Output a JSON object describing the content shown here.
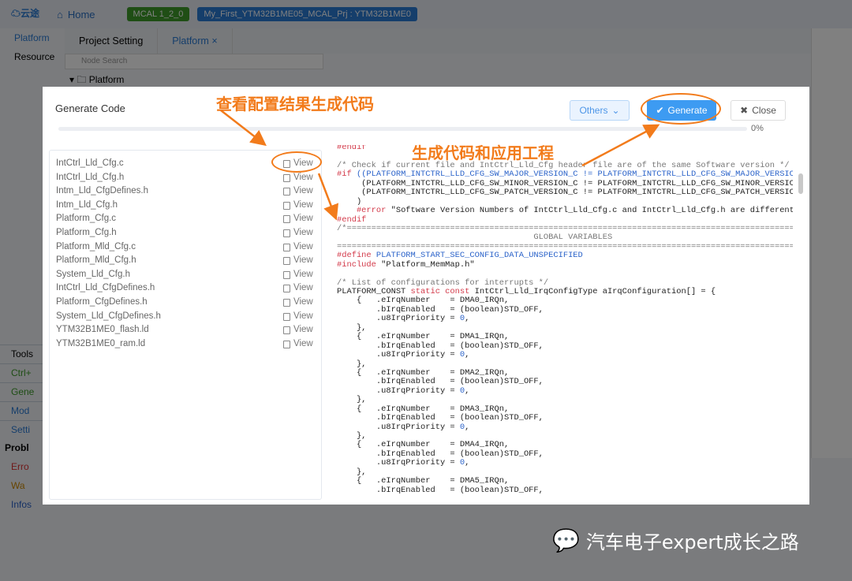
{
  "topbar": {
    "home": "Home",
    "mcal_badge": "MCAL 1_2_0",
    "project_badge": "My_First_YTM32B1ME05_MCAL_Prj : YTM32B1ME0"
  },
  "left_nav": [
    "Platform",
    "Resource"
  ],
  "tabs": [
    {
      "label": "Project Setting"
    },
    {
      "label": "Platform",
      "close": "×"
    }
  ],
  "search": {
    "placeholder": "Node Search"
  },
  "tree": {
    "root": "Platform"
  },
  "tools": {
    "header": "Tools",
    "items": [
      "Ctrl+",
      "Gene",
      "Mod",
      "Setti"
    ]
  },
  "problems": {
    "header": "Probl",
    "items": [
      "Erro",
      "Wa",
      "Infos"
    ]
  },
  "dialog": {
    "title": "Generate Code",
    "others": "Others",
    "generate": "Generate",
    "close": "Close",
    "progress_percent": 0,
    "progress_text": "0%",
    "view_label": "View",
    "files": [
      "IntCtrl_Lld_Cfg.c",
      "IntCtrl_Lld_Cfg.h",
      "Intm_Lld_CfgDefines.h",
      "Intm_Lld_Cfg.h",
      "Platform_Cfg.c",
      "Platform_Cfg.h",
      "Platform_Mld_Cfg.c",
      "Platform_Mld_Cfg.h",
      "System_Lld_Cfg.h",
      "IntCtrl_Lld_CfgDefines.h",
      "Platform_CfgDefines.h",
      "System_Lld_CfgDefines.h",
      "YTM32B1ME0_flash.ld",
      "YTM32B1ME0_ram.ld"
    ],
    "code": [
      [
        [
          "#endif",
          "pp"
        ]
      ],
      [],
      [
        [
          "/* Check if current file and IntCtrl_Lld_Cfg header file are of the same Software version */",
          "cm"
        ]
      ],
      [
        [
          "#if ",
          "pp"
        ],
        [
          "((PLATFORM_INTCTRL_LLD_CFG_SW_MAJOR_VERSION_C != PLATFORM_INTCTRL_LLD_CFG_SW_MAJOR_VERSIC",
          "id"
        ]
      ],
      [
        [
          "     (PLATFORM_INTCTRL_LLD_CFG_SW_MINOR_VERSION_C != PLATFORM_INTCTRL_LLD_CFG_SW_MINOR_VERSIC",
          "tx"
        ]
      ],
      [
        [
          "     (PLATFORM_INTCTRL_LLD_CFG_SW_PATCH_VERSION_C != PLATFORM_INTCTRL_LLD_CFG_SW_PATCH_VERSIC",
          "tx"
        ]
      ],
      [
        [
          "    )",
          "tx"
        ]
      ],
      [
        [
          "    #error ",
          "pp"
        ],
        [
          "\"Software Version Numbers of IntCtrl_Lld_Cfg.c and IntCtrl_Lld_Cfg.h are different",
          "tx"
        ]
      ],
      [
        [
          "#endif",
          "pp"
        ]
      ],
      [
        [
          "/*=============================================================================================",
          "cm"
        ]
      ],
      [
        [
          "                                        GLOBAL VARIABLES",
          "cm"
        ]
      ],
      [
        [
          "==============================================================================================",
          "cm"
        ]
      ],
      [
        [
          "#define ",
          "pp"
        ],
        [
          "PLATFORM_START_SEC_CONFIG_DATA_UNSPECIFIED",
          "id"
        ]
      ],
      [
        [
          "#include ",
          "pp"
        ],
        [
          "\"Platform_MemMap.h\"",
          "tx"
        ]
      ],
      [],
      [
        [
          "/* List of configurations for interrupts */",
          "cm"
        ]
      ],
      [
        [
          "PLATFORM_CONST ",
          "tx"
        ],
        [
          "static const ",
          "kw"
        ],
        [
          "IntCtrl_Lld_IrqConfigType aIrqConfiguration[] = {",
          "tx"
        ]
      ],
      [
        [
          "    {   .eIrqNumber    = DMA0_IRQn,",
          "tx"
        ]
      ],
      [
        [
          "        .bIrqEnabled   = (boolean)STD_OFF,",
          "tx"
        ]
      ],
      [
        [
          "        .u8IrqPriority = ",
          "tx"
        ],
        [
          "0",
          "num"
        ],
        [
          ",",
          "tx"
        ]
      ],
      [
        [
          "    },",
          "tx"
        ]
      ],
      [
        [
          "    {   .eIrqNumber    = DMA1_IRQn,",
          "tx"
        ]
      ],
      [
        [
          "        .bIrqEnabled   = (boolean)STD_OFF,",
          "tx"
        ]
      ],
      [
        [
          "        .u8IrqPriority = ",
          "tx"
        ],
        [
          "0",
          "num"
        ],
        [
          ",",
          "tx"
        ]
      ],
      [
        [
          "    },",
          "tx"
        ]
      ],
      [
        [
          "    {   .eIrqNumber    = DMA2_IRQn,",
          "tx"
        ]
      ],
      [
        [
          "        .bIrqEnabled   = (boolean)STD_OFF,",
          "tx"
        ]
      ],
      [
        [
          "        .u8IrqPriority = ",
          "tx"
        ],
        [
          "0",
          "num"
        ],
        [
          ",",
          "tx"
        ]
      ],
      [
        [
          "    },",
          "tx"
        ]
      ],
      [
        [
          "    {   .eIrqNumber    = DMA3_IRQn,",
          "tx"
        ]
      ],
      [
        [
          "        .bIrqEnabled   = (boolean)STD_OFF,",
          "tx"
        ]
      ],
      [
        [
          "        .u8IrqPriority = ",
          "tx"
        ],
        [
          "0",
          "num"
        ],
        [
          ",",
          "tx"
        ]
      ],
      [
        [
          "    },",
          "tx"
        ]
      ],
      [
        [
          "    {   .eIrqNumber    = DMA4_IRQn,",
          "tx"
        ]
      ],
      [
        [
          "        .bIrqEnabled   = (boolean)STD_OFF,",
          "tx"
        ]
      ],
      [
        [
          "        .u8IrqPriority = ",
          "tx"
        ],
        [
          "0",
          "num"
        ],
        [
          ",",
          "tx"
        ]
      ],
      [
        [
          "    },",
          "tx"
        ]
      ],
      [
        [
          "    {   .eIrqNumber    = DMA5_IRQn,",
          "tx"
        ]
      ],
      [
        [
          "        .bIrqEnabled   = (boolean)STD_OFF,",
          "tx"
        ]
      ]
    ]
  },
  "annotations": {
    "view_config": "查看配置结果生成代码",
    "generate_apply": "生成代码和应用工程"
  },
  "watermark": "汽车电子expert成长之路",
  "colors": {
    "accent": "#3d9bf2",
    "annotation": "#f27b1b",
    "mcal_badge": "#3d9b2a"
  }
}
